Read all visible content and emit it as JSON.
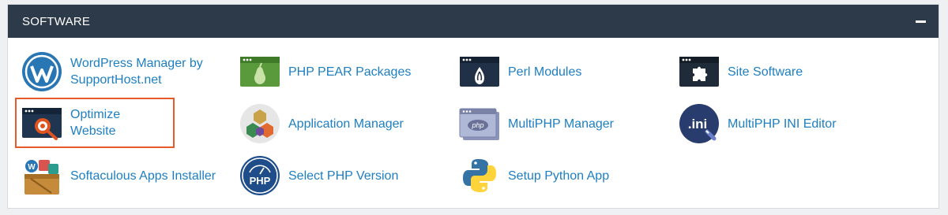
{
  "section": {
    "title": "SOFTWARE",
    "collapse_icon": "minus-icon"
  },
  "items": [
    {
      "label": "WordPress Manager by SupportHost.net",
      "icon": "wordpress-icon"
    },
    {
      "label": "PHP PEAR Packages",
      "icon": "pear-icon"
    },
    {
      "label": "Perl Modules",
      "icon": "perl-icon"
    },
    {
      "label": "Site Software",
      "icon": "puzzle-icon"
    },
    {
      "label": "Optimize Website",
      "icon": "optimize-icon",
      "highlighted": true,
      "highlight_color": "#e85a2c"
    },
    {
      "label": "Application Manager",
      "icon": "cubes-icon"
    },
    {
      "label": "MultiPHP Manager",
      "icon": "php-window-icon"
    },
    {
      "label": "MultiPHP INI Editor",
      "icon": "ini-icon"
    },
    {
      "label": "Softaculous Apps Installer",
      "icon": "softaculous-icon"
    },
    {
      "label": "Select PHP Version",
      "icon": "php-badge-icon"
    },
    {
      "label": "Setup Python App",
      "icon": "python-icon"
    }
  ],
  "colors": {
    "header_bg": "#2d3a4a",
    "link": "#1d7fc1",
    "highlight": "#e85a2c"
  }
}
